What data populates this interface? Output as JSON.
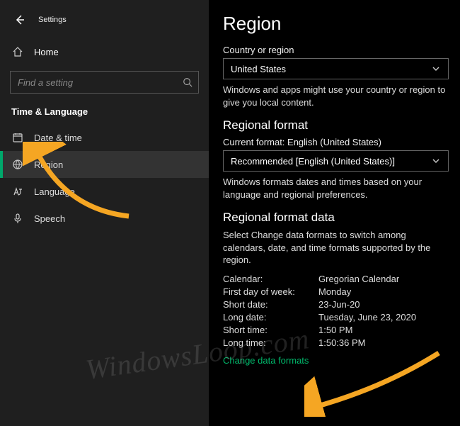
{
  "header": {
    "settings": "Settings"
  },
  "sidebar": {
    "home": "Home",
    "search_placeholder": "Find a setting",
    "category": "Time & Language",
    "items": [
      {
        "label": "Date & time"
      },
      {
        "label": "Region"
      },
      {
        "label": "Language"
      },
      {
        "label": "Speech"
      }
    ]
  },
  "main": {
    "title": "Region",
    "country_label": "Country or region",
    "country_value": "United States",
    "country_desc": "Windows and apps might use your country or region to give you local content.",
    "format_heading": "Regional format",
    "current_format_label": "Current format: English (United States)",
    "format_value": "Recommended [English (United States)]",
    "format_desc": "Windows formats dates and times based on your language and regional preferences.",
    "data_heading": "Regional format data",
    "data_desc": "Select Change data formats to switch among calendars, date, and time formats supported by the region.",
    "rows": {
      "calendar_k": "Calendar:",
      "calendar_v": "Gregorian Calendar",
      "firstday_k": "First day of week:",
      "firstday_v": "Monday",
      "shortdate_k": "Short date:",
      "shortdate_v": "23-Jun-20",
      "longdate_k": "Long date:",
      "longdate_v": "Tuesday, June 23, 2020",
      "shorttime_k": "Short time:",
      "shorttime_v": "1:50 PM",
      "longtime_k": "Long time:",
      "longtime_v": "1:50:36 PM"
    },
    "change_link": "Change data formats"
  },
  "watermark": "WindowsLoop.com"
}
